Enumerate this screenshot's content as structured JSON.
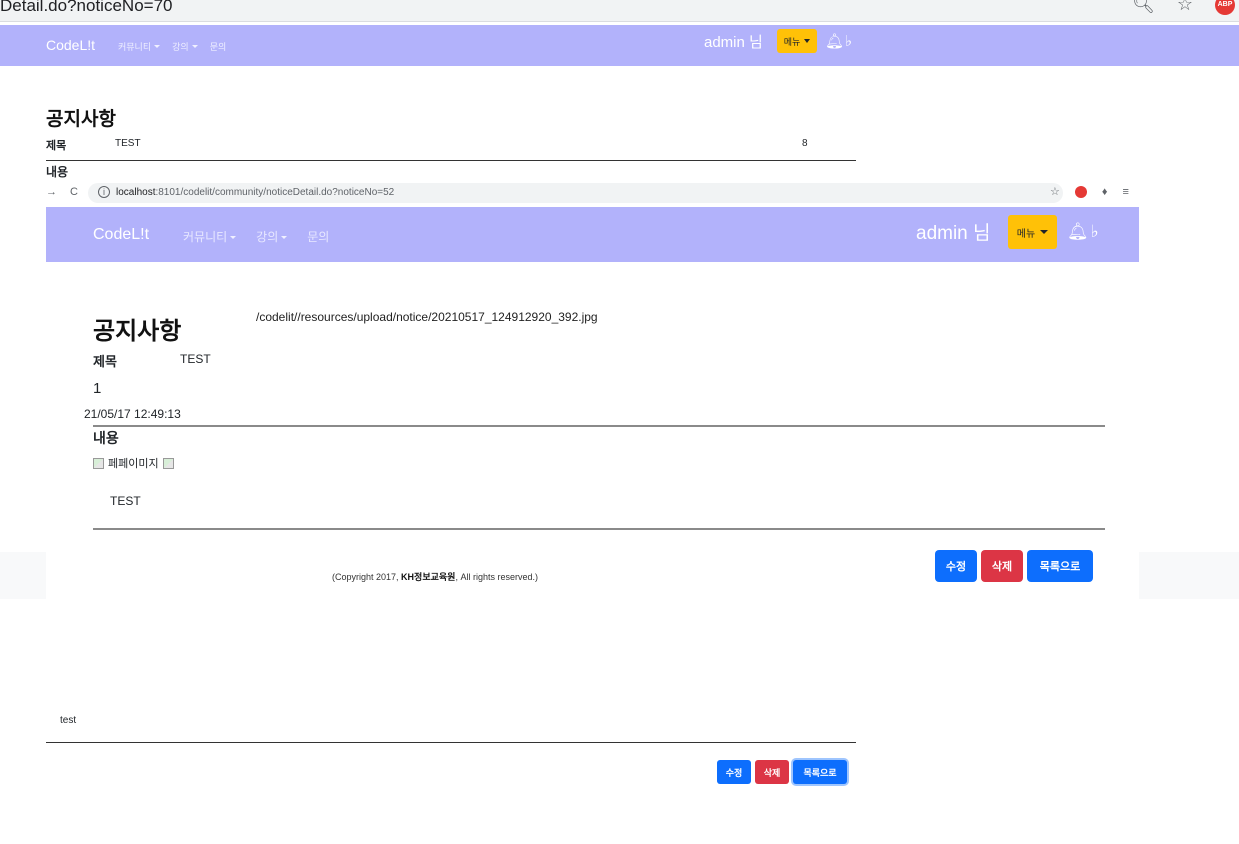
{
  "browser": {
    "url_fragment": "Detail.do?noticeNo=70",
    "icons": [
      "search-icon",
      "star-icon",
      "adblock-icon"
    ]
  },
  "navbar": {
    "brand": "CodeL!t",
    "menu": [
      "커뮤니티",
      "강의",
      "문의"
    ],
    "user": "admin 님",
    "menu_button": "메뉴",
    "color": "#b2b2fb",
    "menu_button_color": "#ffc107"
  },
  "notice": {
    "page_title": "공지사항",
    "subject_label": "제목",
    "subject": "TEST",
    "views": "8",
    "content_label": "내용",
    "body": "test"
  },
  "buttons": {
    "edit": "수정",
    "delete": "삭제",
    "list": "목록으로",
    "colors": {
      "primary": "#0d6efd",
      "danger": "#dc3545"
    }
  },
  "embedded_screenshot": {
    "url_host": "localhost",
    "url_rest": ":8101/codelit/community/noticeDetail.do?noticeNo=52",
    "navbar": {
      "brand": "CodeL!t",
      "menu": [
        "커뮤니티",
        "강의",
        "문의"
      ],
      "user": "admin 님",
      "menu_button": "메뉴"
    },
    "notice": {
      "page_title": "공지사항",
      "image_path": "/codelit//resources/upload/notice/20210517_124912920_392.jpg",
      "subject_label": "제목",
      "subject": "TEST",
      "views": "1",
      "date": "21/05/17 12:49:13",
      "content_label": "내용",
      "image_alt": "페페이미지",
      "body": "TEST"
    },
    "footer": {
      "copyright_prefix": "(Copyright 2017, ",
      "copyright_org": "KH정보교육원",
      "copyright_suffix": ", All rights reserved.)"
    },
    "buttons": {
      "edit": "수정",
      "delete": "삭제",
      "list": "목록으로"
    }
  }
}
